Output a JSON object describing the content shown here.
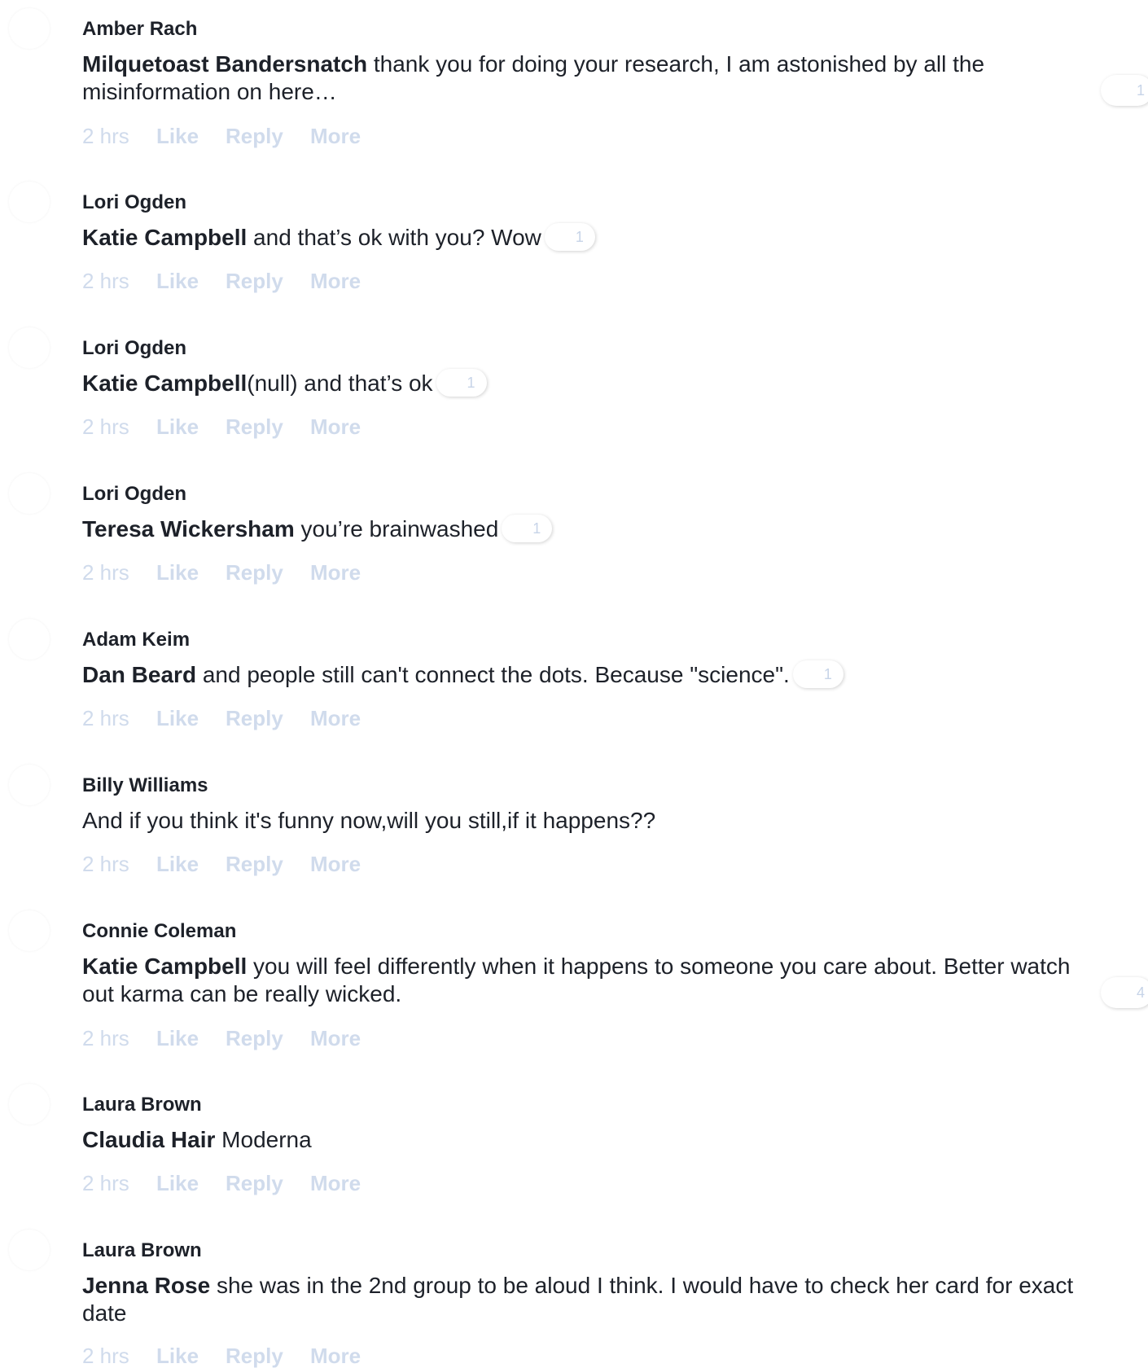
{
  "comments": [
    {
      "author": "Amber Rach",
      "mention": "Milquetoast Bandersnatch",
      "text": " thank you for doing your research, I am astonished by all the misinformation on here…",
      "reactions": "1",
      "timestamp": "2 hrs"
    },
    {
      "author": "Lori Ogden",
      "mention": "Katie Campbell",
      "text": " and that’s ok with you? Wow",
      "reactions": "1",
      "timestamp": "2 hrs"
    },
    {
      "author": "Lori Ogden",
      "mention": "Katie Campbell",
      "text": "(null) and that’s ok",
      "reactions": "1",
      "timestamp": "2 hrs"
    },
    {
      "author": "Lori Ogden",
      "mention": "Teresa Wickersham",
      "text": " you’re brainwashed",
      "reactions": "1",
      "timestamp": "2 hrs"
    },
    {
      "author": "Adam Keim",
      "mention": "Dan Beard",
      "text": " and people still can't connect the dots. Because \"science\".",
      "reactions": "1",
      "timestamp": "2 hrs"
    },
    {
      "author": "Billy Williams",
      "mention": "",
      "text": "And if you think it's funny now,will you still,if it happens??",
      "reactions": "",
      "timestamp": "2 hrs"
    },
    {
      "author": "Connie Coleman",
      "mention": "Katie Campbell",
      "text": " you will feel differently when it happens to someone you care about. Better watch out karma can be really wicked.",
      "reactions": "4",
      "timestamp": "2 hrs"
    },
    {
      "author": "Laura Brown",
      "mention": "Claudia Hair",
      "text": " Moderna",
      "reactions": "",
      "timestamp": "2 hrs"
    },
    {
      "author": "Laura Brown",
      "mention": "Jenna Rose",
      "text": " she was in the 2nd group to be aloud I think. I would have to check her card for exact date",
      "reactions": "",
      "timestamp": "2 hrs"
    }
  ],
  "actions": {
    "like": "Like",
    "reply": "Reply",
    "more": "More"
  },
  "colors": {
    "text": "#1d2129",
    "action": "#d0dbec",
    "reaction_count": "#c7d4e8"
  }
}
